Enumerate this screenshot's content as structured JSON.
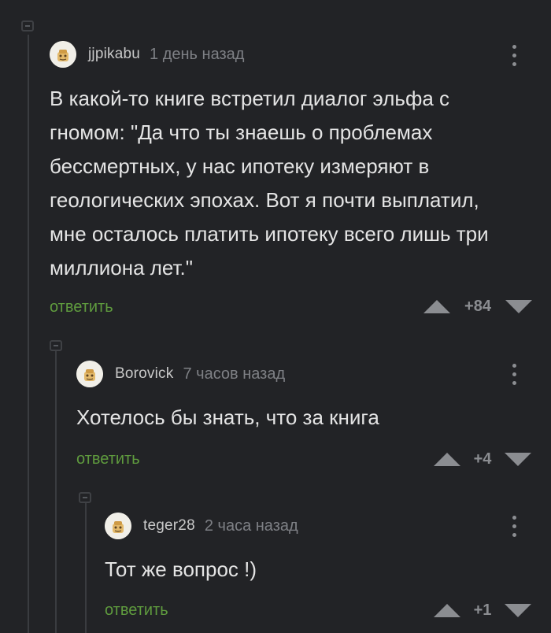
{
  "comments": [
    {
      "username": "jjpikabu",
      "timestamp": "1 день назад",
      "text": "В какой-то книге встретил диалог эльфа с гномом: \"Да что ты знаешь о проблемах бессмертных, у нас ипотеку измеряют в геологических эпохах. Вот я почти выплатил, мне осталось платить ипотеку всего лишь три миллиона лет.\"",
      "reply_label": "ответить",
      "score": "+84"
    },
    {
      "username": "Borovick",
      "timestamp": "7 часов назад",
      "text": "Хотелось бы знать, что за книга",
      "reply_label": "ответить",
      "score": "+4"
    },
    {
      "username": "teger28",
      "timestamp": "2 часа назад",
      "text": "Тот же вопрос !)",
      "reply_label": "ответить",
      "score": "+1"
    }
  ],
  "colors": {
    "background": "#222326",
    "reply_link": "#5f9b3e",
    "vote_icons": "#8b8d91"
  },
  "icons": [
    "collapse-thread-icon",
    "avatar-icon",
    "more-vert-icon",
    "arrow-up-icon",
    "arrow-down-icon"
  ]
}
